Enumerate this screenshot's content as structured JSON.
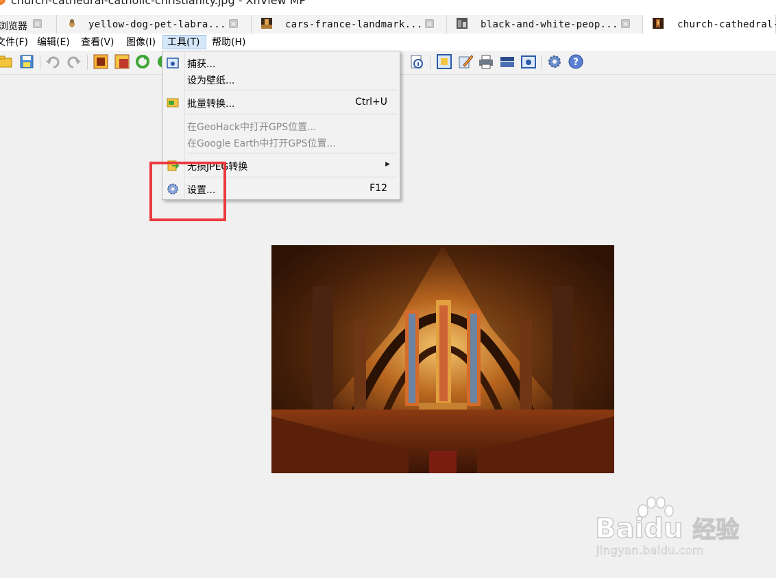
{
  "window": {
    "title": "church-cathedral-catholic-christianity.jpg - XnView MP"
  },
  "tabs": [
    {
      "label": "浏览器",
      "icon": "browser-icon"
    },
    {
      "label": "yellow-dog-pet-labra...",
      "icon": "thumbnail-dog"
    },
    {
      "label": "cars-france-landmark...",
      "icon": "thumbnail-cars"
    },
    {
      "label": "black-and-white-peop...",
      "icon": "thumbnail-bw-people"
    },
    {
      "label": "church-cathedral-c",
      "icon": "thumbnail-church",
      "active": true
    }
  ],
  "menubar": {
    "file": "文件(F)",
    "edit": "编辑(E)",
    "view": "查看(V)",
    "image": "图像(I)",
    "tools": "工具(T)",
    "help": "帮助(H)"
  },
  "toolbar": {
    "buttons": [
      "open-folder-icon",
      "save-icon",
      "undo-icon",
      "redo-icon",
      "crop-icon",
      "resize-icon",
      "rotate-icon",
      "color-icon",
      "info-icon",
      "fit-window-icon",
      "edit-icon",
      "print-icon",
      "scanner-icon",
      "capture-icon",
      "settings-icon",
      "help-icon"
    ]
  },
  "tools_menu": {
    "capture": "捕获...",
    "wallpaper": "设为壁纸...",
    "batch_convert": "批量转换...",
    "batch_convert_shortcut": "Ctrl+U",
    "geohack": "在GeoHack中打开GPS位置...",
    "google_earth": "在Google Earth中打开GPS位置...",
    "lossless_jpeg": "无损JPEG转换",
    "settings": "设置...",
    "settings_shortcut": "F12"
  },
  "highlight_color": "#ea3a3f",
  "image_view": {
    "subject": "cathedral interior photograph"
  },
  "watermark": {
    "brand": "Bai",
    "brand_suffix": "du",
    "cn": "经验",
    "url": "jingyan.baidu.com"
  }
}
